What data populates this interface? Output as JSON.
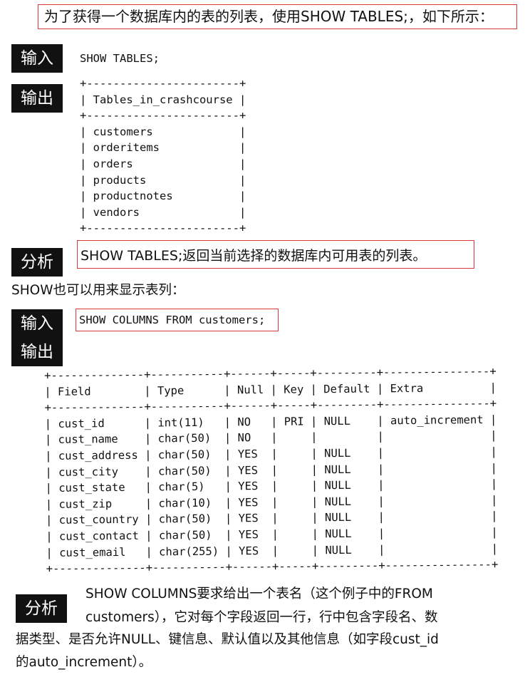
{
  "intro": "为了获得一个数据库内的表的列表，使用SHOW TABLES;，如下所示：",
  "labels": {
    "input": "输入",
    "output": "输出",
    "analysis": "分析"
  },
  "block1": {
    "input_sql": "SHOW TABLES;",
    "output_lines": [
      "+-----------------------+",
      "| Tables_in_crashcourse |",
      "+-----------------------+",
      "| customers             |",
      "| orderitems            |",
      "| orders                |",
      "| products              |",
      "| productnotes          |",
      "| vendors               |",
      "+-----------------------+"
    ],
    "analysis_text": "SHOW TABLES;返回当前选择的数据库内可用表的列表。"
  },
  "para_show": "SHOW也可以用来显示表列：",
  "block2": {
    "input_sql": "SHOW COLUMNS FROM customers;",
    "output_lines": [
      "+--------------+-----------+------+-----+---------+----------------+",
      "| Field        | Type      | Null | Key | Default | Extra          |",
      "+--------------+-----------+------+-----+---------+----------------+",
      "| cust_id      | int(11)   | NO   | PRI | NULL    | auto_increment |",
      "| cust_name    | char(50)  | NO   |     |         |                |",
      "| cust_address | char(50)  | YES  |     | NULL    |                |",
      "| cust_city    | char(50)  | YES  |     | NULL    |                |",
      "| cust_state   | char(5)   | YES  |     | NULL    |                |",
      "| cust_zip     | char(10)  | YES  |     | NULL    |                |",
      "| cust_country | char(50)  | YES  |     | NULL    |                |",
      "| cust_contact | char(50)  | YES  |     | NULL    |                |",
      "| cust_email   | char(255) | YES  |     | NULL    |                |",
      "+--------------+-----------+------+-----+---------+----------------+"
    ]
  },
  "final_analysis": {
    "line1": "SHOW COLUMNS要求给出一个表名（这个例子中的FROM",
    "line2": "customers），它对每个字段返回一行，行中包含字段名、数",
    "line3": "据类型、是否允许NULL、键信息、默认值以及其他信息（如字段cust_id",
    "line4": "的auto_increment）。"
  }
}
